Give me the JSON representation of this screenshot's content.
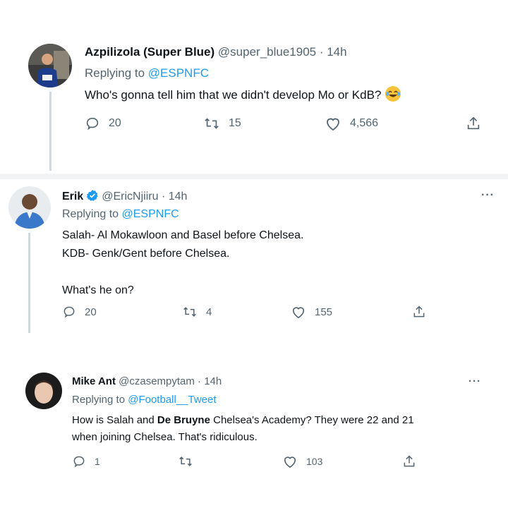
{
  "tweets": [
    {
      "name": "Azpilizola (Super Blue)",
      "handle": "@super_blue1905 · 14h",
      "replying_prefix": "Replying to ",
      "replying_to": "@ESPNFC",
      "lines": [
        "Who's gonna tell him that we didn't develop Mo or KdB?"
      ],
      "emoji": "face-with-tears-of-joy",
      "replies": "20",
      "retweets": "15",
      "likes": "4,566"
    },
    {
      "name": "Erik",
      "handle": "@EricNjiiru · 14h",
      "replying_prefix": "Replying to ",
      "replying_to": "@ESPNFC",
      "lines": [
        "Salah- Al Mokawloon and Basel before Chelsea.",
        "KDB- Genk/Gent before Chelsea.",
        "",
        "What's he on?"
      ],
      "replies": "20",
      "retweets": "4",
      "likes": "155",
      "more": "···"
    },
    {
      "name": "Mike Ant",
      "handle": "@czasempytam · 14h",
      "replying_prefix": "Replying to ",
      "replying_to": "@Football__Tweet",
      "line1_a": "How is Salah and ",
      "line1_bold": "De Bruyne",
      "line1_b": " Chelsea's Academy? They were 22 and 21",
      "line2": "when joining Chelsea. That's ridiculous.",
      "replies": "1",
      "retweets": "",
      "likes": "103",
      "more": "···"
    }
  ],
  "colors": {
    "link": "#1d9bf0",
    "muted": "#536471",
    "text": "#0f1419",
    "verified": "#1d9bf0"
  }
}
